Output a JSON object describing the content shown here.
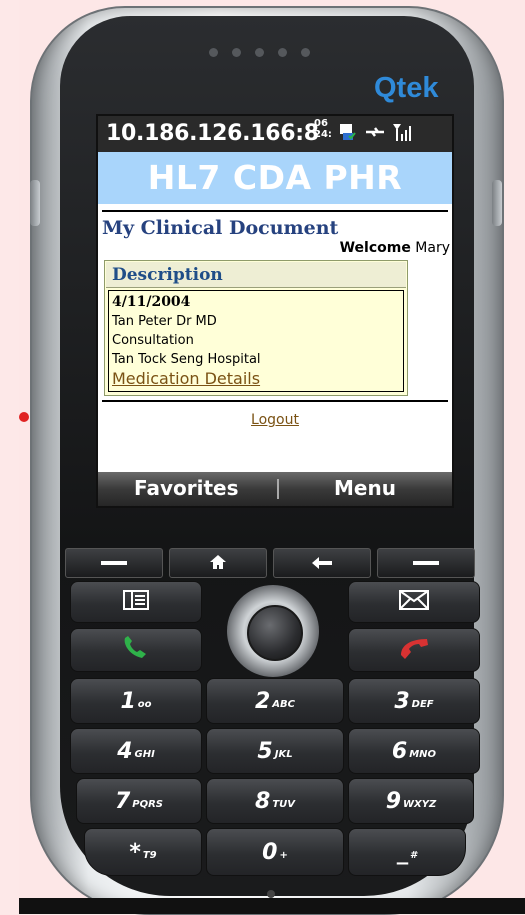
{
  "device": {
    "brand": "Qtek"
  },
  "statusbar": {
    "ip": "10.186.126.166:8",
    "time_top": "06",
    "time_bottom": "24:"
  },
  "app": {
    "header": "HL7 CDA PHR",
    "page_title": "My Clinical Document",
    "welcome_label": "Welcome",
    "welcome_user": "Mary",
    "description": {
      "heading": "Description",
      "date": "4/11/2004",
      "doctor": "Tan Peter Dr MD",
      "type": "Consultation",
      "hospital": "Tan Tock Seng Hospital",
      "link": "Medication Details"
    },
    "logout": "Logout"
  },
  "softkeys": {
    "left": "Favorites",
    "right": "Menu"
  },
  "keypad": {
    "k1": {
      "digit": "1",
      "letters": "oo"
    },
    "k2": {
      "digit": "2",
      "letters": "ABC"
    },
    "k3": {
      "digit": "3",
      "letters": "DEF"
    },
    "k4": {
      "digit": "4",
      "letters": "GHI"
    },
    "k5": {
      "digit": "5",
      "letters": "JKL"
    },
    "k6": {
      "digit": "6",
      "letters": "MNO"
    },
    "k7": {
      "digit": "7",
      "letters": "PQRS"
    },
    "k8": {
      "digit": "8",
      "letters": "TUV"
    },
    "k9": {
      "digit": "9",
      "letters": "WXYZ"
    },
    "kstar": {
      "digit": "*",
      "letters": "T9"
    },
    "k0": {
      "digit": "0",
      "letters": "+"
    },
    "khash": {
      "digit": "_",
      "letters": "#"
    }
  }
}
